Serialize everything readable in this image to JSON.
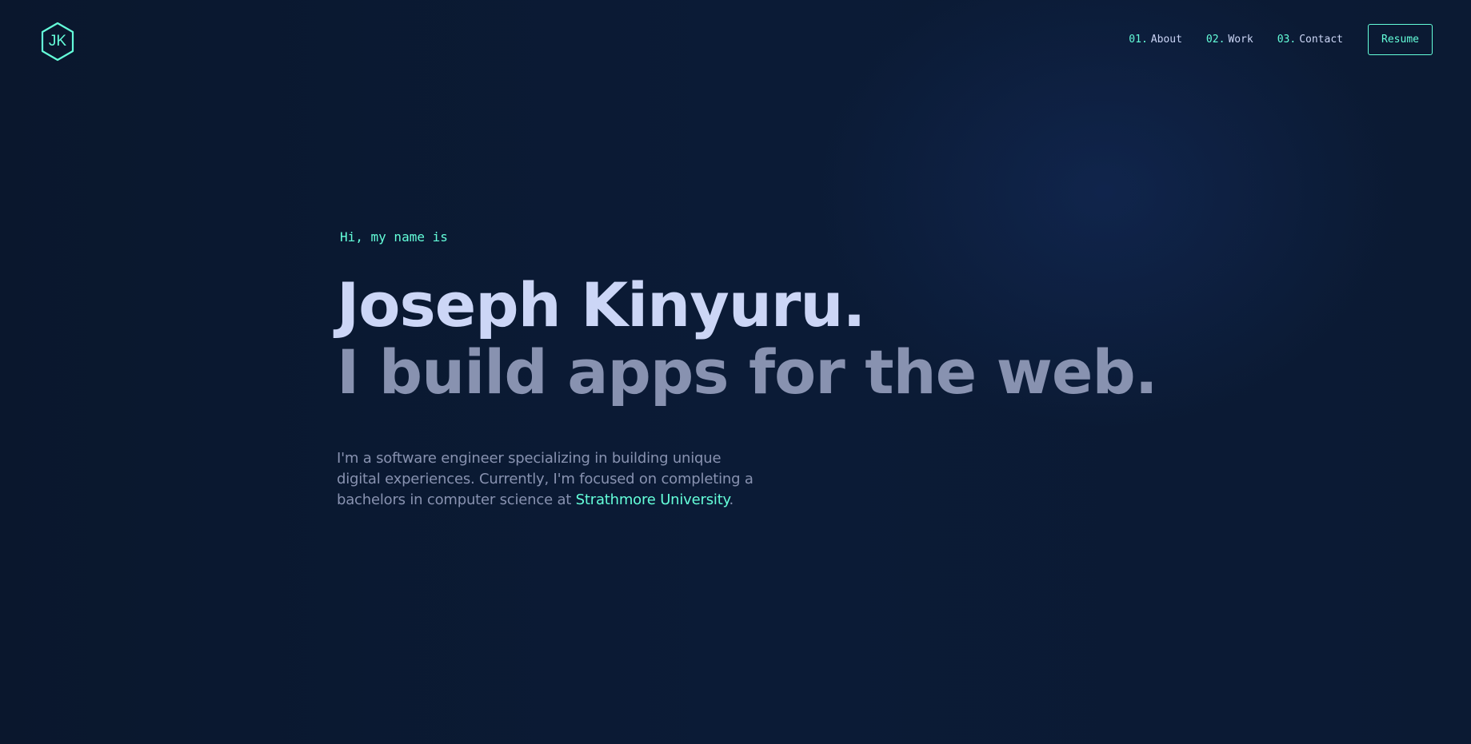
{
  "logo": {
    "initials": "JK",
    "shape": "hexagon-icon",
    "color": "#64ffda"
  },
  "nav": {
    "items": [
      {
        "number": "01.",
        "label": "About"
      },
      {
        "number": "02.",
        "label": "Work"
      },
      {
        "number": "03.",
        "label": "Contact"
      }
    ],
    "resume_label": "Resume"
  },
  "hero": {
    "greeting": "Hi, my name is",
    "name": "Joseph Kinyuru.",
    "tagline": "I build apps for the web.",
    "intro": {
      "line1": "I'm a software engineer specializing in building unique",
      "line2": "digital experiences. Currently, I'm focused on completing a",
      "line3_prefix": "bachelors in computer science at ",
      "link_text": "Strathmore University",
      "line3_suffix": "."
    }
  },
  "colors": {
    "background": "#0b1a33",
    "accent": "#64ffda",
    "heading": "#ccd6f6",
    "muted": "#8892b0"
  }
}
